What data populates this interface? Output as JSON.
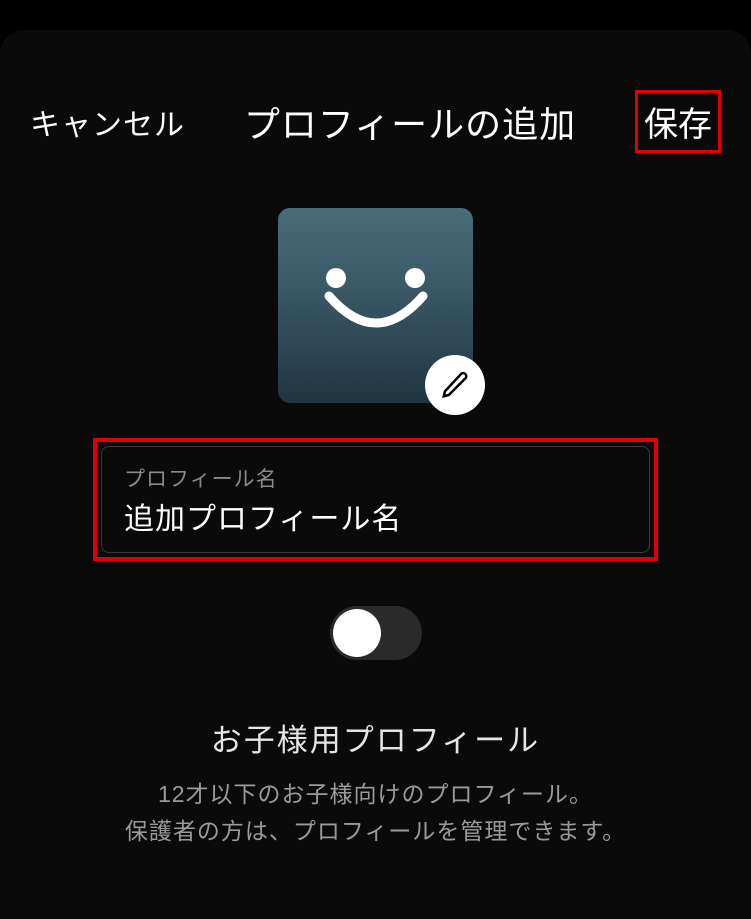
{
  "header": {
    "cancel_label": "キャンセル",
    "title": "プロフィールの追加",
    "save_label": "保存"
  },
  "avatar": {
    "icon_name": "smiley-avatar",
    "edit_icon_name": "pencil-icon"
  },
  "name_field": {
    "label": "プロフィール名",
    "value": "追加プロフィール名"
  },
  "kids_toggle": {
    "state": "off",
    "title": "お子様用プロフィール",
    "description_line1": "12才以下のお子様向けのプロフィール。",
    "description_line2": "保護者の方は、プロフィールを管理できます。"
  },
  "highlight_color": "#e00000"
}
